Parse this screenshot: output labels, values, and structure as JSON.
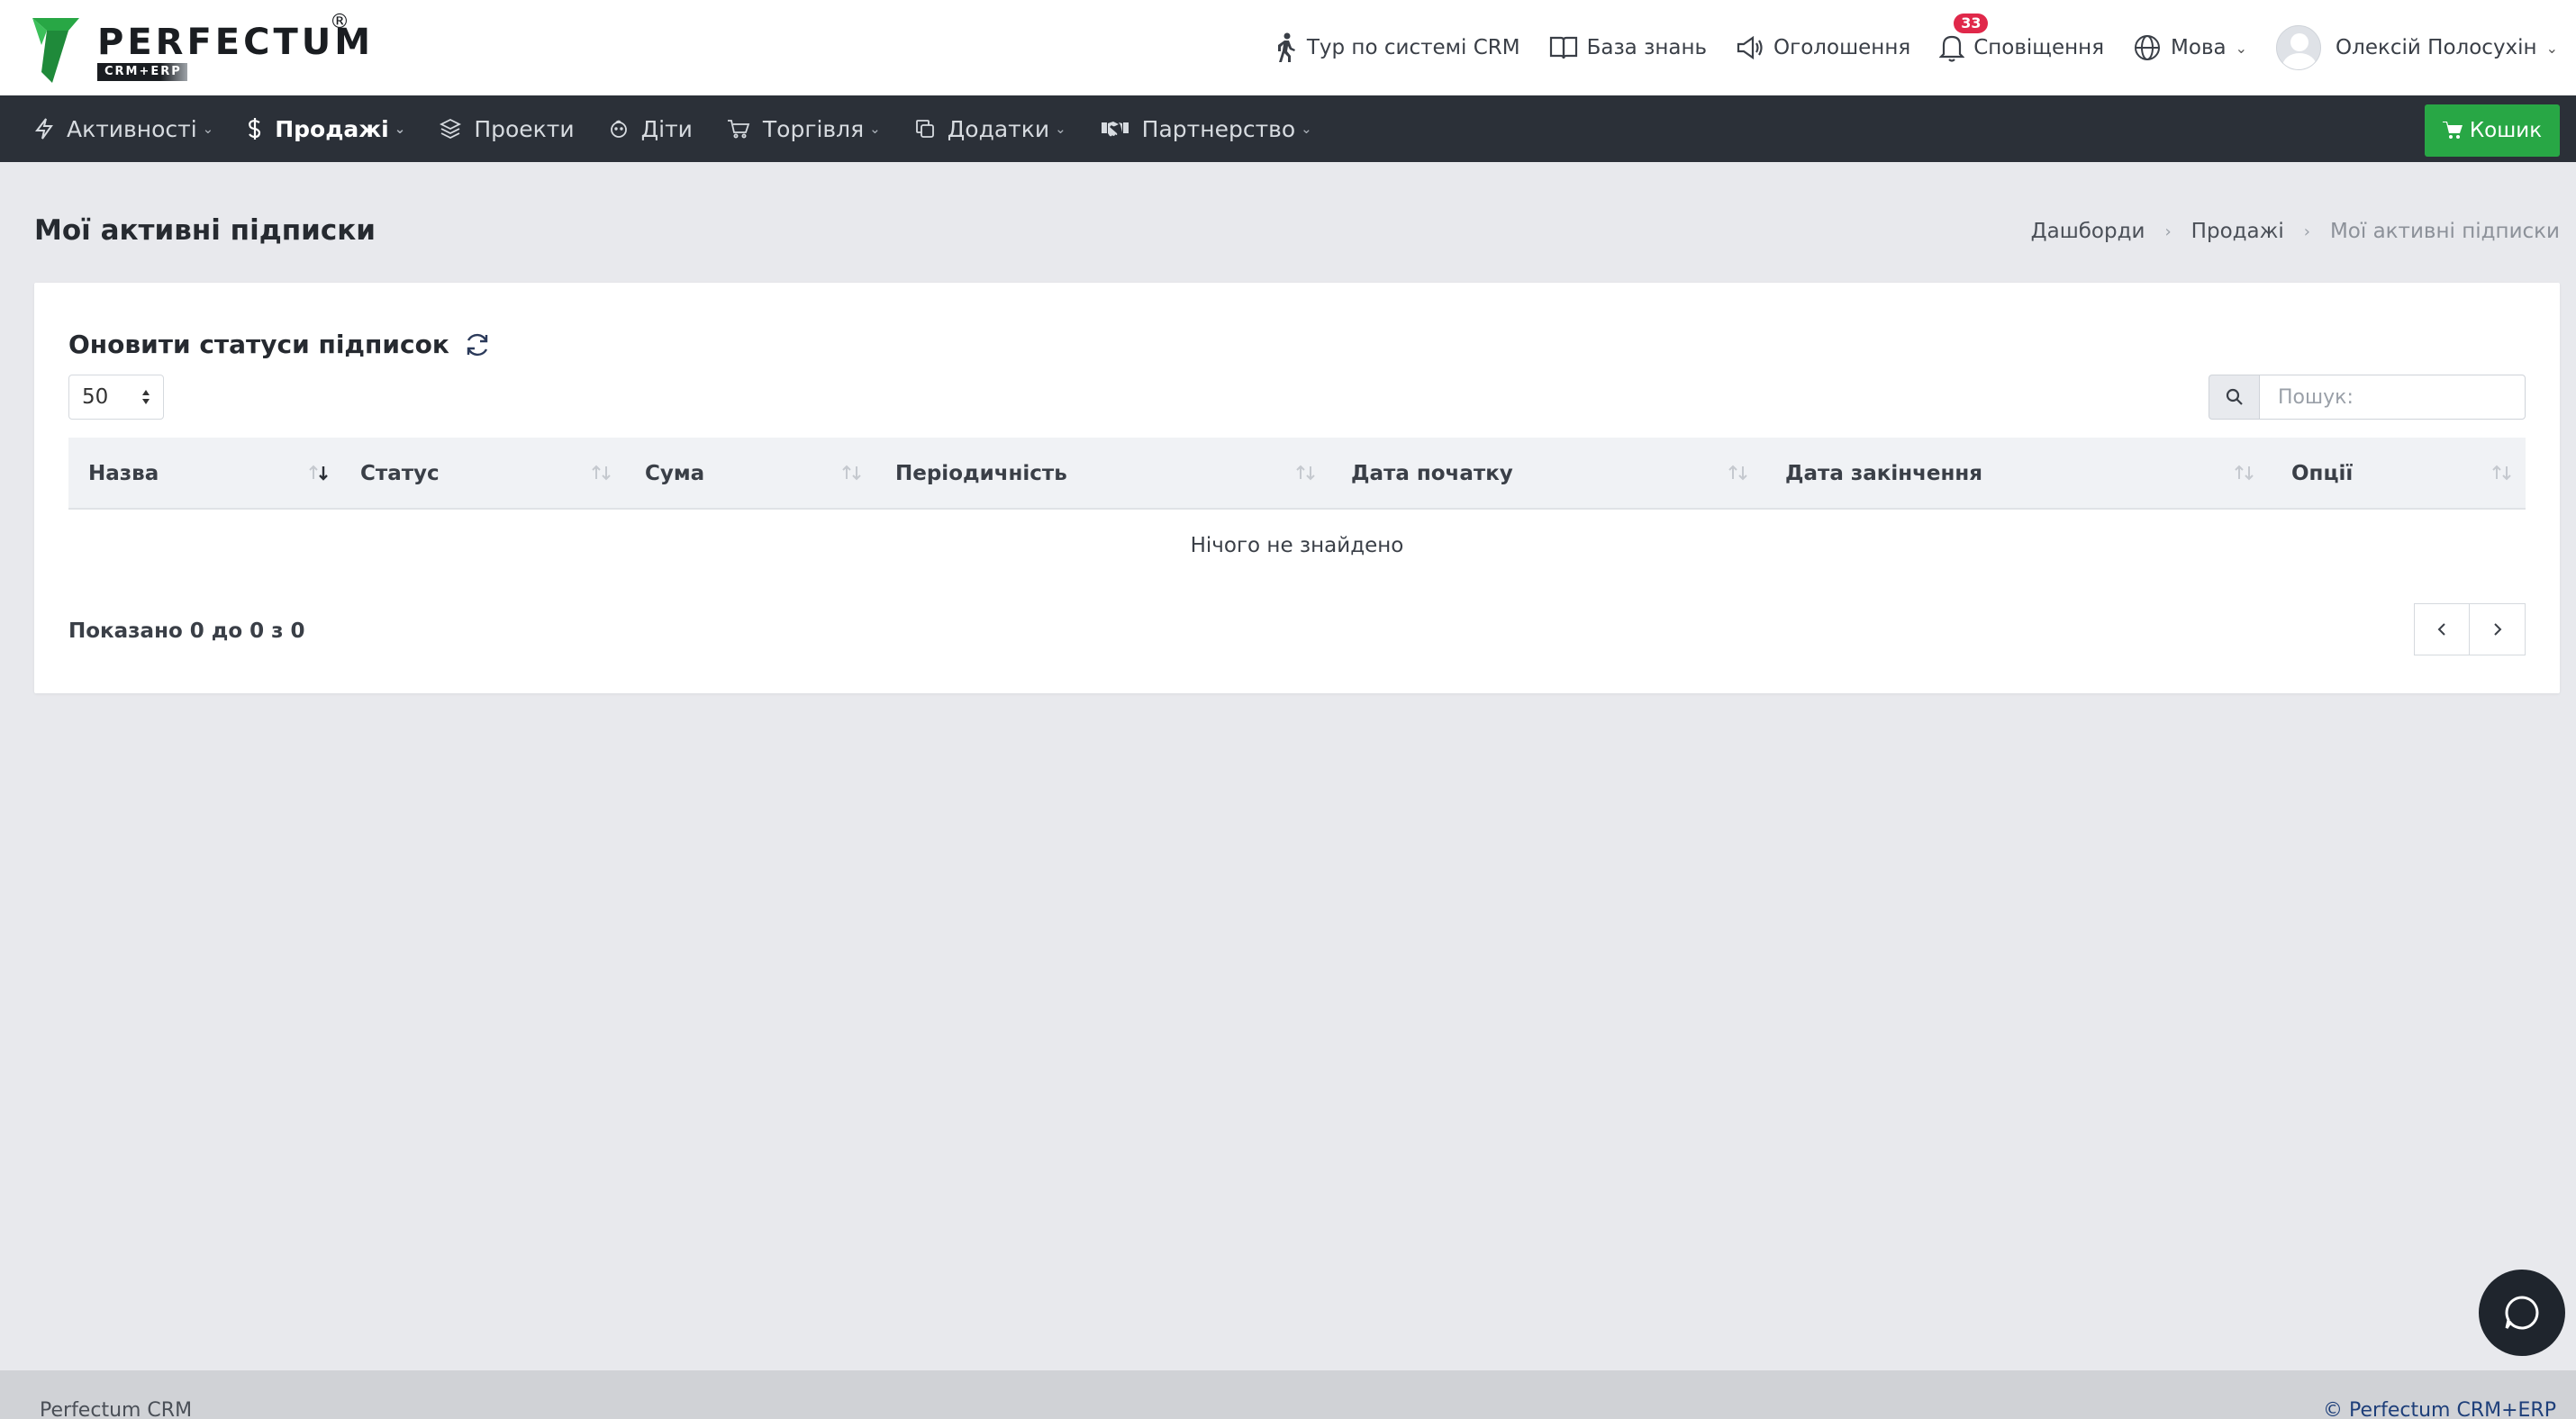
{
  "brand": {
    "name": "PERFECTUM",
    "sub": "CRM+ERP",
    "reg": "®",
    "colors": {
      "green": "#28a745",
      "nav_bg": "#2b3038",
      "badge": "#e0284a"
    }
  },
  "top_nav": {
    "tour": "Тур по системі CRM",
    "knowledge": "База знань",
    "announcements": "Оголошення",
    "notifications": "Сповіщення",
    "notifications_count": "33",
    "language": "Мова",
    "user": "Олексій Полосухін"
  },
  "main_nav": {
    "items": [
      {
        "label": "Активності",
        "icon": "bolt-icon"
      },
      {
        "label": "Продажі",
        "icon": "dollar-icon"
      },
      {
        "label": "Проекти",
        "icon": "layers-icon"
      },
      {
        "label": "Діти",
        "icon": "child-icon"
      },
      {
        "label": "Торгівля",
        "icon": "cart-icon"
      },
      {
        "label": "Додатки",
        "icon": "copy-icon"
      },
      {
        "label": "Партнерство",
        "icon": "handshake-icon"
      }
    ],
    "cart_button": "Кошик"
  },
  "page": {
    "title": "Мої активні підписки",
    "breadcrumb": [
      "Дашборди",
      "Продажі",
      "Мої активні підписки"
    ]
  },
  "card": {
    "title": "Оновити статуси підписок",
    "page_length": "50",
    "search_placeholder": "Пошук:",
    "columns": [
      "Назва",
      "Статус",
      "Сума",
      "Періодичність",
      "Дата початку",
      "Дата закінчення",
      "Опції"
    ],
    "empty_text": "Нічого не знайдено",
    "info": "Показано 0 до 0 з 0"
  },
  "footer": {
    "left": "Perfectum CRM",
    "right": "© Perfectum CRM+ERP"
  }
}
